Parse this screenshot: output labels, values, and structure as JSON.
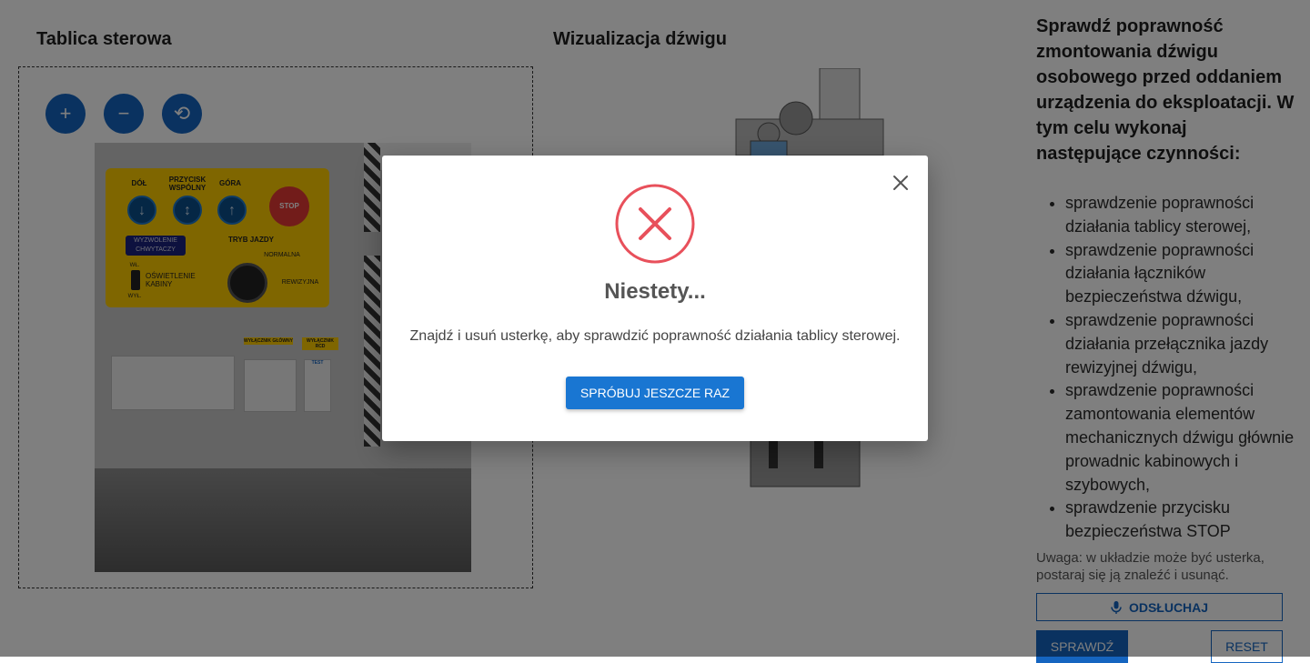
{
  "board_panel": {
    "title": "Tablica sterowa",
    "zoom_in": "+",
    "zoom_out": "−",
    "reset_view": "⟲",
    "control_panel": {
      "down_label": "DÓŁ",
      "common_label": "PRZYCISK WSPÓLNY",
      "up_label": "GÓRA",
      "stop_label": "STOP",
      "catch_release_label": "WYZWOLENIE CHWYTACZY",
      "travel_mode_label": "TRYB JAZDY",
      "normal_label": "NORMALNA",
      "inspection_label": "REWIZYJNA",
      "on_label": "WŁ.",
      "off_label": "WYŁ.",
      "cabin_light_label": "OŚWIETLENIE KABINY",
      "main_switch_label": "WYŁĄCZNIK GŁÓWNY",
      "rcd_switch_label": "WYŁĄCZNIK RCD",
      "test_label": "TEST"
    }
  },
  "viz_panel": {
    "title": "Wizualizacja dźwigu"
  },
  "instructions": {
    "title": "Sprawdź poprawność zmontowania dźwigu osobowego przed oddaniem urządzenia do eksploatacji. W tym celu wykonaj następujące czynności:",
    "steps": [
      "sprawdzenie poprawności działania tablicy sterowej,",
      "sprawdzenie poprawności działania łączników bezpieczeństwa dźwigu,",
      "sprawdzenie poprawności działania przełącznika jazdy rewizyjnej dźwigu,",
      "sprawdzenie poprawności zamontowania elementów mechanicznych dźwigu głównie prowadnic kabinowych i szybowych,",
      "sprawdzenie przycisku bezpieczeństwa STOP"
    ],
    "note": "Uwaga: w układzie może być usterka, postaraj się ją znaleźć i usunąć.",
    "listen_button": "ODSŁUCHAJ",
    "check_button": "SPRAWDŹ",
    "reset_button": "RESET"
  },
  "modal": {
    "title": "Niestety...",
    "message": "Znajdź i usuń usterkę, aby sprawdzić poprawność działania tablicy sterowej.",
    "retry_button": "SPRÓBUJ JESZCZE RAZ",
    "error_color": "#e8505b"
  }
}
